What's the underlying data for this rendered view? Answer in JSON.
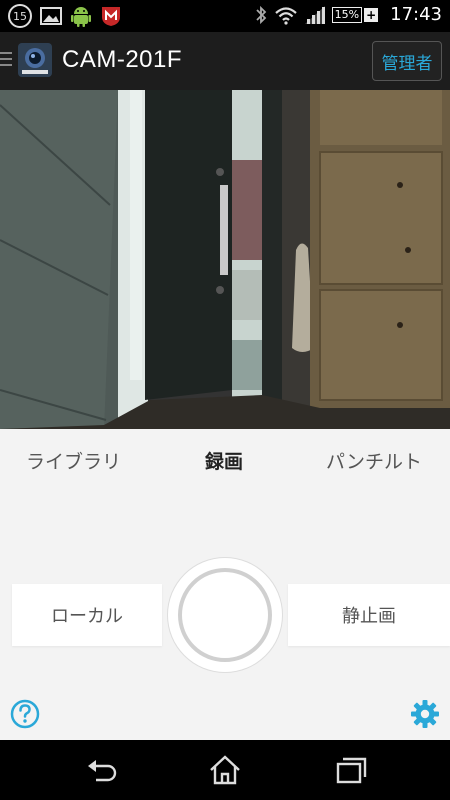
{
  "status_bar": {
    "badge": "15",
    "battery": "15%",
    "battery_plus": "+",
    "time": "17:43"
  },
  "app_bar": {
    "title": "CAM-201F",
    "admin_button": "管理者"
  },
  "tabs": [
    {
      "label": "ライブラリ",
      "active": false
    },
    {
      "label": "録画",
      "active": true
    },
    {
      "label": "パンチルト",
      "active": false
    }
  ],
  "actions": {
    "local_label": "ローカル",
    "still_label": "静止画"
  },
  "colors": {
    "accent": "#2aa8d8",
    "app_bar_bg": "#1d1d1d",
    "control_bg": "#f3f3f3"
  },
  "icons": {
    "help": "help-circle-icon",
    "settings": "gear-icon",
    "nav": [
      "back-icon",
      "home-icon",
      "recent-apps-icon"
    ]
  }
}
